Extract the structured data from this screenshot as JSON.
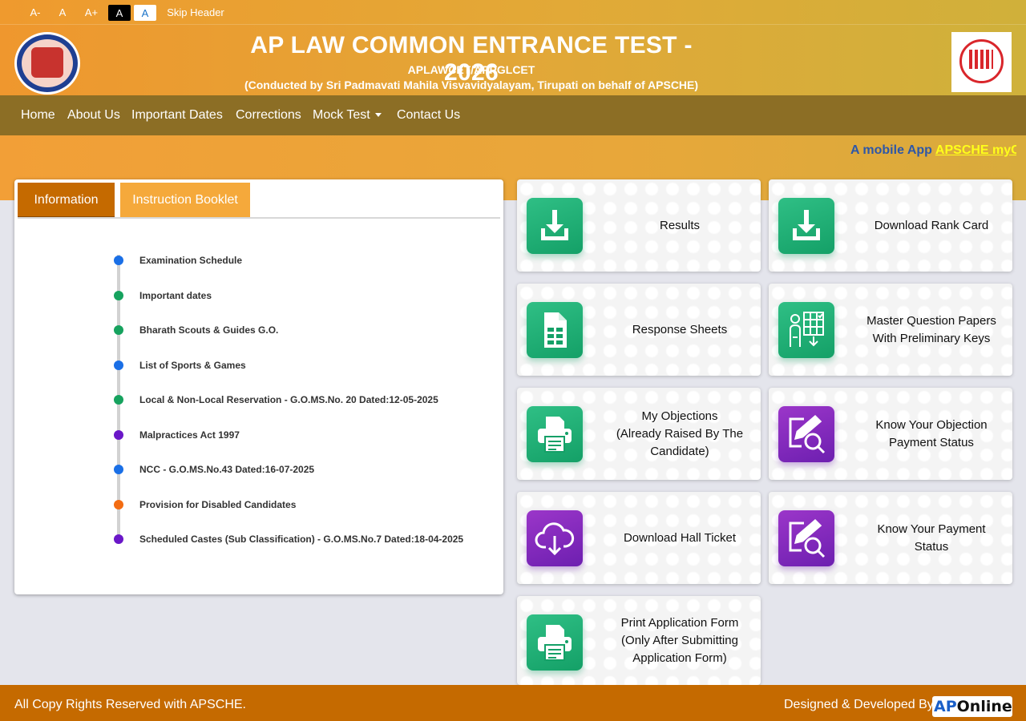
{
  "accessibility": {
    "decrease": "A-",
    "normal": "A",
    "increase": "A+",
    "dark_theme": "A",
    "light_theme": "A",
    "skip_header": "Skip Header"
  },
  "header": {
    "title": "AP LAW COMMON ENTRANCE TEST - 2026",
    "subtitle": "APLAWCET/APPGLCET",
    "conducted_by": "(Conducted by Sri Padmavati Mahila Visvavidyalayam, Tirupati on behalf of APSCHE)"
  },
  "nav": {
    "items": [
      "Home",
      "About Us",
      "Important Dates",
      "Corrections",
      "Mock Test",
      "Contact Us"
    ]
  },
  "marquee": {
    "text": "A mobile App",
    "link": "APSCHE myC"
  },
  "info": {
    "tabs": [
      "Information",
      "Instruction Booklet"
    ],
    "items": [
      {
        "label": "Examination Schedule",
        "color": "#1a6fe6"
      },
      {
        "label": "Important dates",
        "color": "#16a25e"
      },
      {
        "label": "Bharath Scouts & Guides G.O.",
        "color": "#16a25e"
      },
      {
        "label": "List of Sports & Games",
        "color": "#1a6fe6"
      },
      {
        "label": "Local & Non-Local Reservation - G.O.MS.No. 20 Dated:12-05-2025",
        "color": "#16a25e"
      },
      {
        "label": "Malpractices Act 1997",
        "color": "#6a17c8"
      },
      {
        "label": "NCC - G.O.MS.No.43 Dated:16-07-2025",
        "color": "#1a6fe6"
      },
      {
        "label": "Provision for Disabled Candidates",
        "color": "#f36c12"
      },
      {
        "label": "Scheduled Castes (Sub Classification) - G.O.MS.No.7 Dated:18-04-2025",
        "color": "#6a17c8"
      }
    ]
  },
  "tiles": [
    {
      "label": "Results",
      "icon": "download-icon",
      "color": "green"
    },
    {
      "label": "Download Rank Card",
      "icon": "download-icon",
      "color": "green"
    },
    {
      "label": "Response Sheets",
      "icon": "spreadsheet-icon",
      "color": "green"
    },
    {
      "label": "Master Question Papers\nWith Preliminary Keys",
      "icon": "question-paper-icon",
      "color": "green"
    },
    {
      "label": "My Objections\n(Already Raised By The\nCandidate)",
      "icon": "printer-icon",
      "color": "green"
    },
    {
      "label": "Know Your Objection\nPayment Status",
      "icon": "edit-search-icon",
      "color": "purple"
    },
    {
      "label": "Download Hall Ticket",
      "icon": "cloud-download-icon",
      "color": "purple"
    },
    {
      "label": "Know Your Payment\nStatus",
      "icon": "edit-search-icon",
      "color": "purple"
    },
    {
      "label": "Print Application Form\n(Only After Submitting\nApplication Form)",
      "icon": "printer-icon",
      "color": "green"
    }
  ],
  "footer": {
    "copyright": "All Copy Rights Reserved with APSCHE.",
    "designed_by": "Designed & Developed By",
    "brand_ap": "AP",
    "brand_online": "Online"
  }
}
